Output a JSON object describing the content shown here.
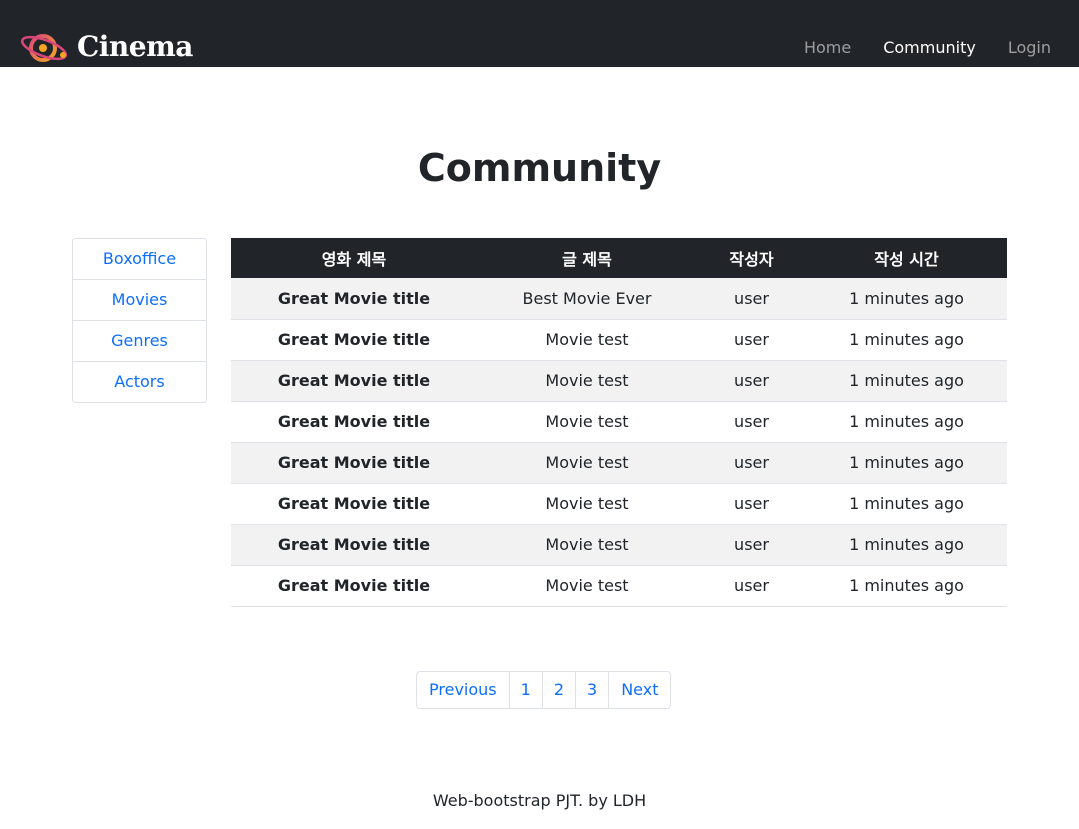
{
  "navbar": {
    "brand": "Cinema",
    "logo_icon": "planet-logo-icon",
    "colors": {
      "background": "#212529",
      "brand_text": "#ffffff",
      "logo_orange": "#f5a623",
      "logo_pink": "#d9467a"
    },
    "links": [
      {
        "label": "Home",
        "active": false
      },
      {
        "label": "Community",
        "active": true
      },
      {
        "label": "Login",
        "active": false
      }
    ]
  },
  "page": {
    "title": "Community"
  },
  "sidebar": {
    "link_color": "#0d6efd",
    "items": [
      {
        "label": "Boxoffice"
      },
      {
        "label": "Movies"
      },
      {
        "label": "Genres"
      },
      {
        "label": "Actors"
      }
    ]
  },
  "table": {
    "header_bg": "#212529",
    "stripe_bg": "#f2f2f2",
    "columns": [
      "영화 제목",
      "글 제목",
      "작성자",
      "작성 시간"
    ],
    "rows": [
      {
        "movie": "Great Movie title",
        "title": "Best Movie Ever",
        "author": "user",
        "time": "1 minutes ago"
      },
      {
        "movie": "Great Movie title",
        "title": "Movie test",
        "author": "user",
        "time": "1 minutes ago"
      },
      {
        "movie": "Great Movie title",
        "title": "Movie test",
        "author": "user",
        "time": "1 minutes ago"
      },
      {
        "movie": "Great Movie title",
        "title": "Movie test",
        "author": "user",
        "time": "1 minutes ago"
      },
      {
        "movie": "Great Movie title",
        "title": "Movie test",
        "author": "user",
        "time": "1 minutes ago"
      },
      {
        "movie": "Great Movie title",
        "title": "Movie test",
        "author": "user",
        "time": "1 minutes ago"
      },
      {
        "movie": "Great Movie title",
        "title": "Movie test",
        "author": "user",
        "time": "1 minutes ago"
      },
      {
        "movie": "Great Movie title",
        "title": "Movie test",
        "author": "user",
        "time": "1 minutes ago"
      }
    ]
  },
  "pagination": {
    "previous": "Previous",
    "pages": [
      "1",
      "2",
      "3"
    ],
    "next": "Next"
  },
  "footer": {
    "text": "Web-bootstrap PJT. by LDH"
  }
}
